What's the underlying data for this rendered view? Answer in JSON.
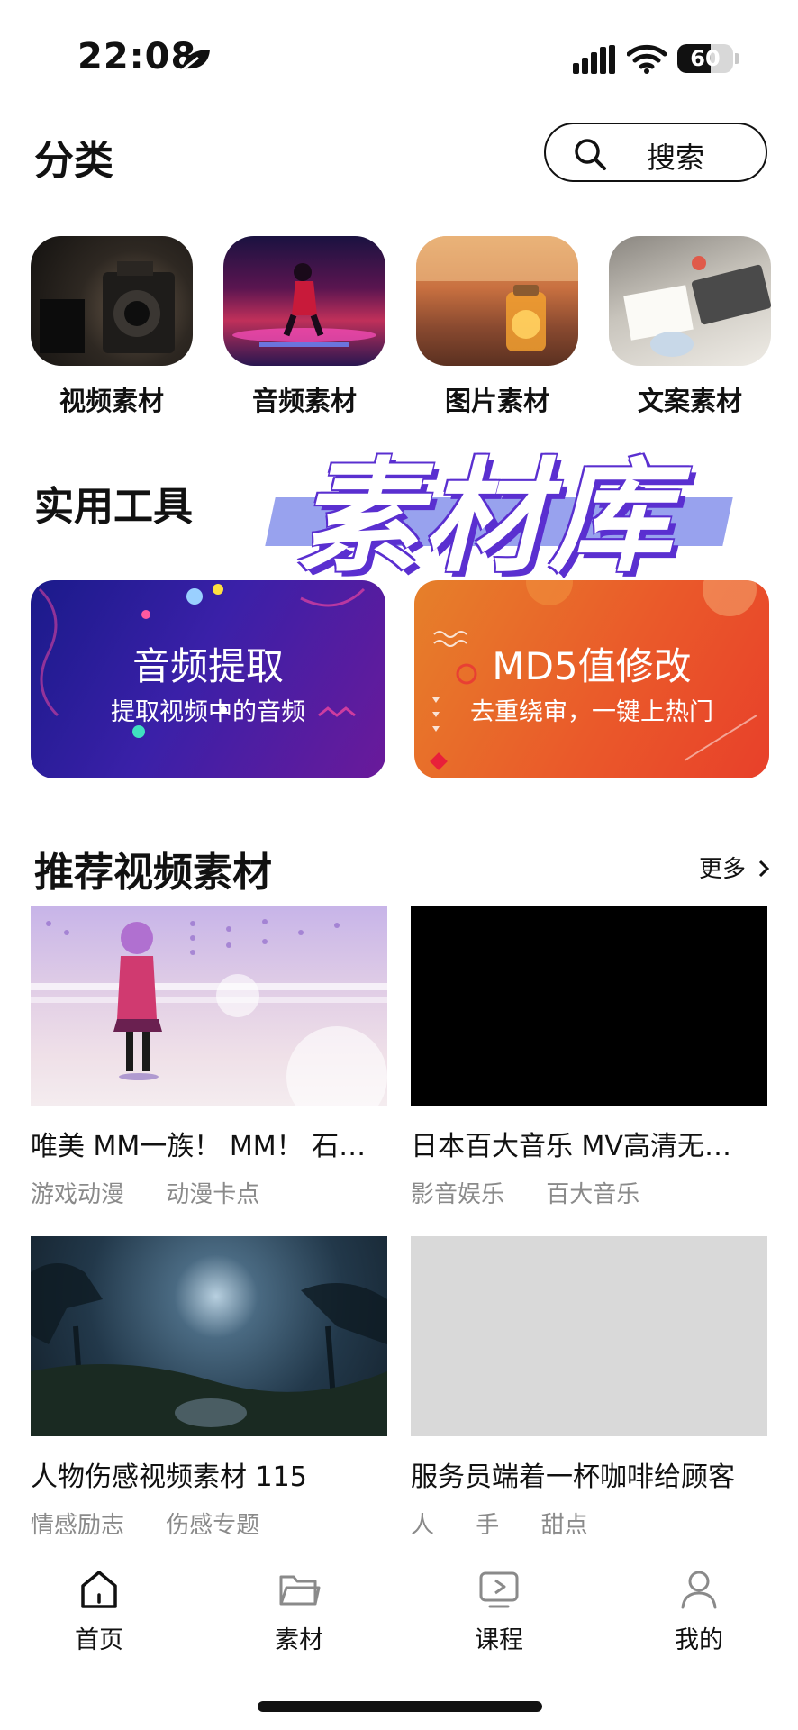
{
  "status_bar": {
    "time": "22:08",
    "battery": "60",
    "battery_level": 0.6
  },
  "header": {
    "title": "分类",
    "search_label": "搜索"
  },
  "categories": [
    {
      "label": "视频素材"
    },
    {
      "label": "音频素材"
    },
    {
      "label": "图片素材"
    },
    {
      "label": "文案素材"
    }
  ],
  "watermark": "素材库",
  "tools": {
    "title": "实用工具",
    "items": [
      {
        "title": "音频提取",
        "subtitle": "提取视频中的音频"
      },
      {
        "title": "MD5值修改",
        "subtitle": "去重绕审，一键上热门"
      }
    ]
  },
  "recommend": {
    "title": "推荐视频素材",
    "more": "更多",
    "videos": [
      {
        "title": "唯美 MM一族！ MM！ 石…",
        "tags": [
          "游戏动漫",
          "动漫卡点"
        ]
      },
      {
        "title": "日本百大音乐 MV高清无…",
        "tags": [
          "影音娱乐",
          "百大音乐"
        ]
      },
      {
        "title": "人物伤感视频素材 115",
        "tags": [
          "情感励志",
          "伤感专题"
        ]
      },
      {
        "title": "服务员端着一杯咖啡给顾客",
        "tags": [
          "人",
          "手",
          "甜点"
        ]
      }
    ]
  },
  "nav": {
    "items": [
      {
        "label": "首页",
        "icon": "home-icon"
      },
      {
        "label": "素材",
        "icon": "folder-icon"
      },
      {
        "label": "课程",
        "icon": "play-screen-icon"
      },
      {
        "label": "我的",
        "icon": "user-icon"
      }
    ]
  }
}
